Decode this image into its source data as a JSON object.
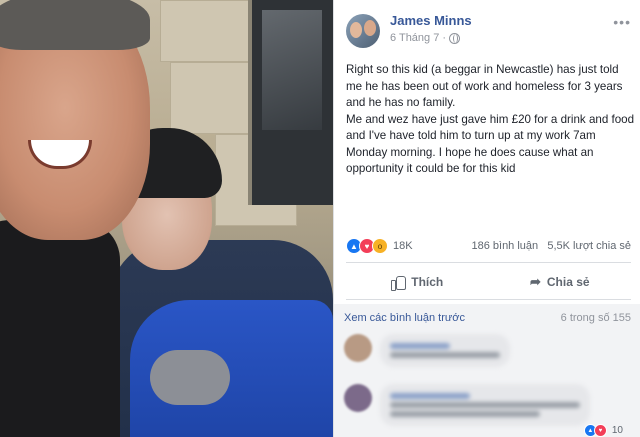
{
  "post": {
    "author": "James Minns",
    "date": "6 Tháng 7",
    "paragraphs": [
      "Right so this kid (a beggar in Newcastle) has just told me he has been out of work and homeless for 3 years and he has no family.",
      "Me and wez have just gave him £20 for a drink and food and I've have told him to turn up at my work 7am Monday morning. I hope he does cause what an opportunity it could be for this kid"
    ]
  },
  "reactions": {
    "count": "18K",
    "comments": "186 bình luận",
    "shares": "5,5K lượt chia sẻ"
  },
  "actions": {
    "like": "Thích",
    "share": "Chia sẻ"
  },
  "comments_section": {
    "view_previous": "Xem các bình luận trước",
    "count_label": "6 trong số 155",
    "reply_count": "10"
  },
  "colors": {
    "link": "#385898",
    "like": "#1877f2",
    "love": "#f33e58",
    "wow": "#f7b125"
  },
  "icons": [
    "globe-icon",
    "more-icon",
    "like-icon",
    "share-icon"
  ]
}
